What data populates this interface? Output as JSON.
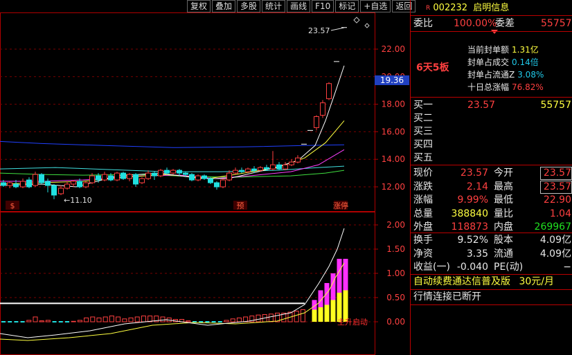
{
  "toolbar": {
    "buttons": [
      "复权",
      "叠加",
      "多股",
      "统计",
      "画线",
      "F10",
      "标记",
      "+自选",
      "返回"
    ]
  },
  "stock": {
    "badge": "R",
    "code": "002232",
    "name": "启明信息"
  },
  "committee": {
    "ratio_label": "委比",
    "ratio_value": "100.00%",
    "diff_label": "委差",
    "diff_value": "55757"
  },
  "seal": {
    "board_text": "6天5板",
    "lines": [
      {
        "label": "当前封单额",
        "value": "1.31亿"
      },
      {
        "label": "封单占成交",
        "value": "0.14倍"
      },
      {
        "label": "封单占流通Z",
        "value": "3.08%"
      },
      {
        "label": "十日总涨幅",
        "value": "76.82%"
      }
    ]
  },
  "orderbook": [
    {
      "label": "买一",
      "price": "23.57",
      "vol": "55757"
    },
    {
      "label": "买二",
      "price": "",
      "vol": ""
    },
    {
      "label": "买三",
      "price": "",
      "vol": ""
    },
    {
      "label": "买四",
      "price": "",
      "vol": ""
    },
    {
      "label": "买五",
      "price": "",
      "vol": ""
    }
  ],
  "quote": {
    "now_label": "现价",
    "now": "23.57",
    "open_label": "今开",
    "open": "23.57",
    "chg_label": "涨跌",
    "chg": "2.14",
    "high_label": "最高",
    "high": "23.57",
    "pct_label": "涨幅",
    "pct": "9.99%",
    "low_label": "最低",
    "low": "22.90",
    "vol_label": "总量",
    "vol": "388840",
    "vr_label": "量比",
    "vr": "1.04",
    "outer_label": "外盘",
    "outer": "118873",
    "inner_label": "内盘",
    "inner": "269967"
  },
  "fundamentals": {
    "turnover_label": "换手",
    "turnover": "9.52%",
    "shares_label": "股本",
    "shares": "4.09亿",
    "nav_label": "净资",
    "nav": "3.35",
    "float_label": "流通",
    "float": "4.09亿",
    "eps_label": "收益(一)",
    "eps": "-0.040",
    "pe_label": "PE(动)",
    "pe": "−"
  },
  "footer": {
    "ad_text": "自动续费通达信普及版",
    "ad_price": "30元/月",
    "status": "行情连接已断开"
  },
  "price_chart": {
    "y_ticks": [
      "22.00",
      "20.00",
      "18.00",
      "16.00",
      "14.00",
      "12.00"
    ],
    "current_tag": "19.36",
    "high_annotation": "23.57",
    "low_annotation": "11.10",
    "markers": {
      "left": "$",
      "mid": "预",
      "right": "涨停"
    }
  },
  "indicator_chart": {
    "y_ticks": [
      "2.00",
      "1.50",
      "1.00",
      "0.50",
      "0.00"
    ],
    "start_label": "主升启动"
  },
  "colors": {
    "up": "#ff4040",
    "down": "#20e0e0",
    "panel_border": "#b00000",
    "ma_blue": "#2040ff",
    "ma_yellow": "#ffff40",
    "ma_magenta": "#ff40ff",
    "ma_green": "#40e040"
  }
}
